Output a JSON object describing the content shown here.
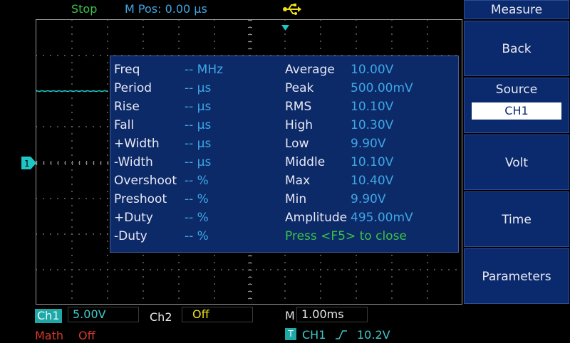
{
  "status": {
    "run_state": "Stop",
    "m_pos": "M Pos: 0.00 µs"
  },
  "colors": {
    "run_state": "#39c24a",
    "mpos": "#3fa6e6",
    "usb": "#f0e018",
    "trace": "#1fc6c6",
    "math": "#d63a2a"
  },
  "icons": {
    "usb": "usb-icon",
    "trigger_position": "trigger-position-marker-icon",
    "ch1_marker": "ch1-ground-marker-icon",
    "trigger": "trigger-icon",
    "rising_edge": "rising-edge-icon"
  },
  "measure_panel": {
    "left_rows": [
      {
        "label": "Freq",
        "value": "-- MHz"
      },
      {
        "label": "Period",
        "value": "-- µs"
      },
      {
        "label": "Rise",
        "value": "-- µs"
      },
      {
        "label": "Fall",
        "value": "-- µs"
      },
      {
        "label": "+Width",
        "value": "-- µs"
      },
      {
        "label": "-Width",
        "value": "-- µs"
      },
      {
        "label": "Overshoot",
        "value": "-- %"
      },
      {
        "label": "Preshoot",
        "value": "-- %"
      },
      {
        "label": "+Duty",
        "value": "-- %"
      },
      {
        "label": "-Duty",
        "value": "-- %"
      }
    ],
    "right_rows": [
      {
        "label": "Average",
        "value": "10.00V"
      },
      {
        "label": "Peak",
        "value": "500.00mV"
      },
      {
        "label": "RMS",
        "value": "10.10V"
      },
      {
        "label": "High",
        "value": "10.30V"
      },
      {
        "label": "Low",
        "value": "9.90V"
      },
      {
        "label": "Middle",
        "value": "10.10V"
      },
      {
        "label": "Max",
        "value": "10.40V"
      },
      {
        "label": "Min",
        "value": "9.90V"
      },
      {
        "label": "Amplitude",
        "value": "495.00mV"
      }
    ],
    "close_hint": "Press <F5> to close"
  },
  "side_menu": {
    "title": "Measure",
    "back": "Back",
    "source_label": "Source",
    "source_value": "CH1",
    "volt": "Volt",
    "time": "Time",
    "parameters": "Parameters"
  },
  "bottom": {
    "ch1_label": "Ch1",
    "ch1_scale": "5.00V",
    "ch2_label": "Ch2",
    "ch2_state": "Off",
    "timebase_prefix": "M",
    "timebase": "1.00ms",
    "math_label": "Math",
    "math_state": "Off",
    "trigger_badge": "T",
    "trigger_source": "CH1",
    "trigger_level": "10.2V"
  }
}
